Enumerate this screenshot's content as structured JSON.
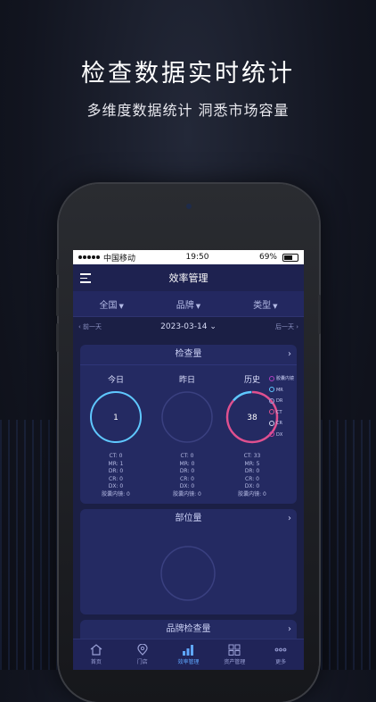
{
  "promo": {
    "title": "检查数据实时统计",
    "subtitle": "多维度数据统计 洞悉市场容量"
  },
  "statusbar": {
    "carrier": "中国移动",
    "time": "19:50",
    "battery": "69%"
  },
  "header": {
    "title": "效率管理"
  },
  "filters": [
    {
      "label": "全国"
    },
    {
      "label": "品牌"
    },
    {
      "label": "类型"
    }
  ],
  "datebar": {
    "prev": "前一天",
    "date": "2023-03-14",
    "next": "后一天"
  },
  "cards": {
    "exam": {
      "title": "检查量",
      "columns": [
        {
          "label": "今日",
          "value": "1",
          "stats": [
            "CT: 0",
            "MR: 1",
            "DR: 0",
            "CR: 0",
            "DX: 0",
            "胶囊内镜: 0"
          ]
        },
        {
          "label": "昨日",
          "value": "",
          "stats": [
            "CT: 0",
            "MR: 0",
            "DR: 0",
            "CR: 0",
            "DX: 0",
            "胶囊内镜: 0"
          ]
        },
        {
          "label": "历史",
          "value": "38",
          "stats": [
            "CT: 33",
            "MR: 5",
            "DR: 0",
            "CR: 0",
            "DX: 0",
            "胶囊内镜: 0"
          ]
        }
      ],
      "legend": [
        {
          "label": "胶囊内镜",
          "color": "#b040c0"
        },
        {
          "label": "MR",
          "color": "#5fc8ff"
        },
        {
          "label": "DR",
          "color": "#9aa0d6"
        },
        {
          "label": "CT",
          "color": "#e0508f"
        },
        {
          "label": "CR",
          "color": "#d4d8f0"
        },
        {
          "label": "DX",
          "color": "#d040a0"
        }
      ]
    },
    "part": {
      "title": "部位量"
    },
    "brand": {
      "title": "品牌检查量"
    }
  },
  "tabbar": [
    {
      "label": "首页",
      "icon": "home-icon"
    },
    {
      "label": "门店",
      "icon": "location-icon"
    },
    {
      "label": "效率管理",
      "icon": "bar-chart-icon"
    },
    {
      "label": "资产管理",
      "icon": "grid-icon"
    },
    {
      "label": "更多",
      "icon": "more-icon"
    }
  ],
  "colors": {
    "ring_today": "#5fc8ff",
    "ring_history_ct": "#e0508f",
    "ring_history_mr": "#5fc8ff",
    "ring_empty": "#3a4080",
    "active_tab": "#5fa7ff"
  }
}
